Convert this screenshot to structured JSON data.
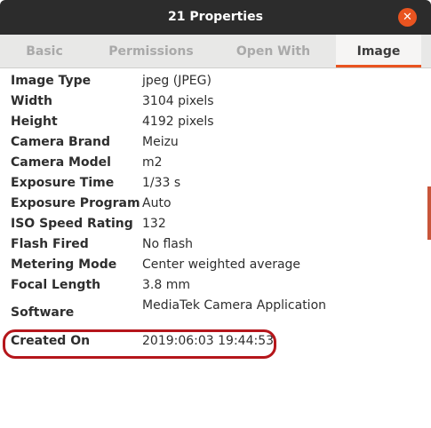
{
  "window": {
    "title": "21 Properties",
    "close_glyph": "✕",
    "accent_color": "#e95420"
  },
  "tabs": [
    {
      "label": "Basic",
      "active": false
    },
    {
      "label": "Permissions",
      "active": false
    },
    {
      "label": "Open With",
      "active": false
    },
    {
      "label": "Image",
      "active": true
    }
  ],
  "properties": [
    {
      "label": "Image Type",
      "value": "jpeg (JPEG)"
    },
    {
      "label": "Width",
      "value": "3104 pixels"
    },
    {
      "label": "Height",
      "value": "4192 pixels"
    },
    {
      "label": "Camera Brand",
      "value": "Meizu"
    },
    {
      "label": "Camera Model",
      "value": "m2"
    },
    {
      "label": "Exposure Time",
      "value": "1/33 s"
    },
    {
      "label": "Exposure Program",
      "value": "Auto"
    },
    {
      "label": "ISO Speed Rating",
      "value": "132"
    },
    {
      "label": "Flash Fired",
      "value": "No flash"
    },
    {
      "label": "Metering Mode",
      "value": "Center weighted average"
    },
    {
      "label": "Focal Length",
      "value": "3.8 mm"
    },
    {
      "label": "Software",
      "value": "MediaTek Camera Application"
    },
    {
      "label": "Created On",
      "value": "2019:06:03 19:44:53"
    }
  ],
  "highlight": {
    "row_label": "Created On",
    "color": "#b5161b"
  }
}
